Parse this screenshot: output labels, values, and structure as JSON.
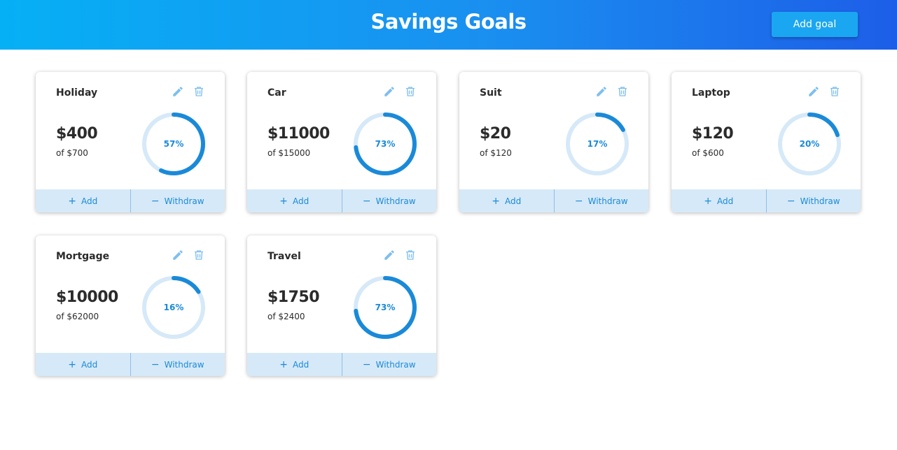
{
  "header": {
    "title": "Savings Goals",
    "add_goal_label": "Add goal"
  },
  "colors": {
    "accent": "#1a8ad8",
    "ring_track": "#d6e9f8",
    "footer_bg": "#d6e9f8",
    "header_start": "#06b0f5",
    "header_end": "#1d5ee8"
  },
  "icons": {
    "edit": "pencil-icon",
    "delete": "trash-icon",
    "add": "plus-icon",
    "withdraw": "minus-icon"
  },
  "goals": [
    {
      "name": "Holiday",
      "saved": "$400",
      "target": "of $700",
      "percent_label": "57%",
      "progress": 57,
      "add_label": "Add",
      "withdraw_label": "Withdraw"
    },
    {
      "name": "Car",
      "saved": "$11000",
      "target": "of $15000",
      "percent_label": "73%",
      "progress": 73,
      "add_label": "Add",
      "withdraw_label": "Withdraw"
    },
    {
      "name": "Suit",
      "saved": "$20",
      "target": "of $120",
      "percent_label": "17%",
      "progress": 17,
      "add_label": "Add",
      "withdraw_label": "Withdraw"
    },
    {
      "name": "Laptop",
      "saved": "$120",
      "target": "of $600",
      "percent_label": "20%",
      "progress": 20,
      "add_label": "Add",
      "withdraw_label": "Withdraw"
    },
    {
      "name": "Mortgage",
      "saved": "$10000",
      "target": "of $62000",
      "percent_label": "16%",
      "progress": 16,
      "add_label": "Add",
      "withdraw_label": "Withdraw"
    },
    {
      "name": "Travel",
      "saved": "$1750",
      "target": "of $2400",
      "percent_label": "73%",
      "progress": 73,
      "add_label": "Add",
      "withdraw_label": "Withdraw"
    }
  ]
}
